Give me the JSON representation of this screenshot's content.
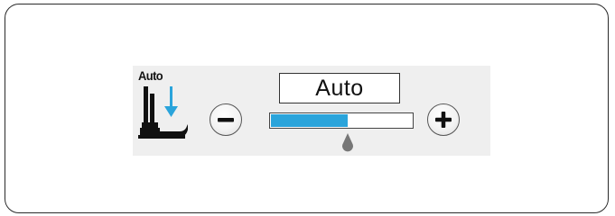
{
  "presser_foot": {
    "icon_label": "Auto"
  },
  "controls": {
    "display_value": "Auto",
    "level": 0.55,
    "minus_icon": "minus-icon",
    "plus_icon": "plus-icon"
  },
  "colors": {
    "accent": "#2aa4db",
    "panel": "#efefef",
    "knob": "#777777"
  }
}
